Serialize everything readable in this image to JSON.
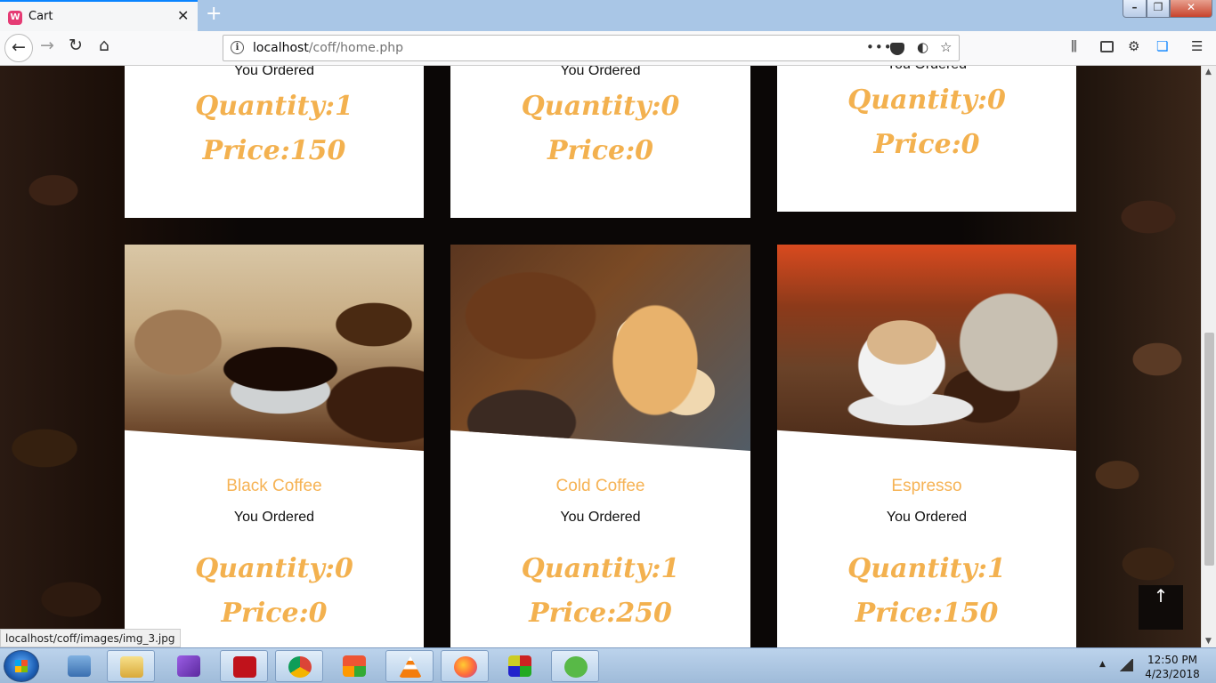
{
  "browser": {
    "tab_title": "Cart",
    "tab_icon": "W",
    "close_glyph": "✕",
    "newtab_glyph": "+",
    "url_host": "localhost",
    "url_path": "/coff/home.php",
    "status_link": "localhost/coff/images/img_3.jpg"
  },
  "top_row": [
    {
      "ordered": "You Ordered",
      "quantity": "Quantity:1",
      "price": "Price:150"
    },
    {
      "ordered": "You Ordered",
      "quantity": "Quantity:0",
      "price": "Price:0"
    },
    {
      "ordered": "You Ordered",
      "quantity": "Quantity:0",
      "price": "Price:0"
    }
  ],
  "products": [
    {
      "name": "Black Coffee",
      "ordered": "You Ordered",
      "quantity": "Quantity:0",
      "price": "Price:0"
    },
    {
      "name": "Cold Coffee",
      "ordered": "You Ordered",
      "quantity": "Quantity:1",
      "price": "Price:250"
    },
    {
      "name": "Espresso",
      "ordered": "You Ordered",
      "quantity": "Quantity:1",
      "price": "Price:150"
    }
  ],
  "back_to_top_glyph": "↑",
  "taskbar": {
    "time": "12:50 PM",
    "date": "4/23/2018",
    "apps": [
      "control-panel",
      "file-explorer",
      "visual-studio",
      "acrobat",
      "chrome",
      "app-grid",
      "vlc",
      "firefox",
      "winrar",
      "utorrent"
    ]
  },
  "colors": {
    "accent": "#f3b14f",
    "product_name": "#f6b355",
    "firefox_accent": "#0a84ff"
  }
}
